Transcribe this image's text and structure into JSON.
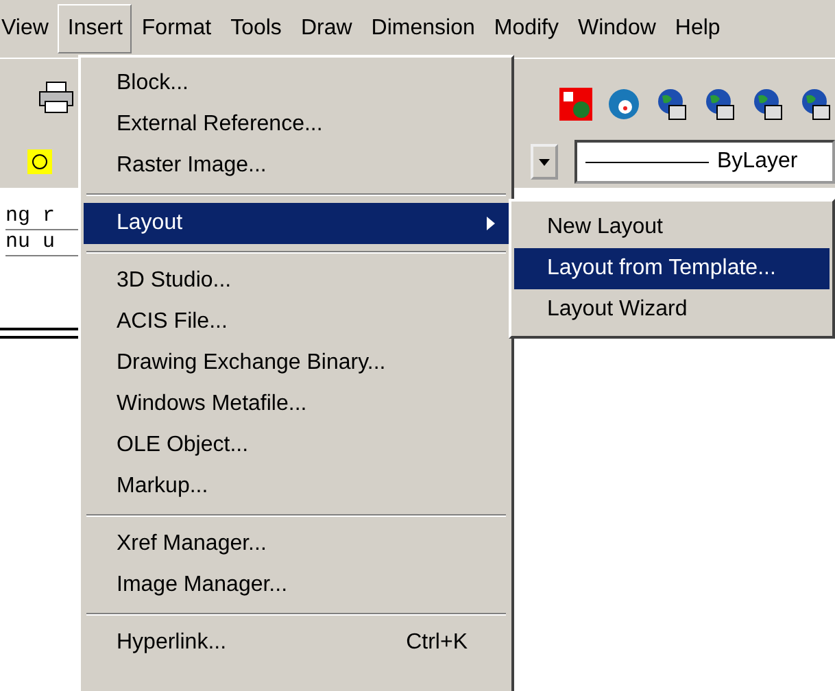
{
  "menubar": [
    {
      "label": "View",
      "selected": false
    },
    {
      "label": "Insert",
      "selected": true
    },
    {
      "label": "Format",
      "selected": false
    },
    {
      "label": "Tools",
      "selected": false
    },
    {
      "label": "Draw",
      "selected": false
    },
    {
      "label": "Dimension",
      "selected": false
    },
    {
      "label": "Modify",
      "selected": false
    },
    {
      "label": "Window",
      "selected": false
    },
    {
      "label": "Help",
      "selected": false
    }
  ],
  "linetype_field": {
    "value": "ByLayer"
  },
  "command_lines": [
    "ng r",
    "nu u"
  ],
  "insert_menu": [
    {
      "kind": "item",
      "label": "Block...",
      "selected": false
    },
    {
      "kind": "item",
      "label": "External Reference...",
      "selected": false
    },
    {
      "kind": "item",
      "label": "Raster Image...",
      "selected": false
    },
    {
      "kind": "separator"
    },
    {
      "kind": "submenu",
      "label": "Layout",
      "selected": true
    },
    {
      "kind": "separator"
    },
    {
      "kind": "item",
      "label": "3D Studio...",
      "selected": false
    },
    {
      "kind": "item",
      "label": "ACIS File...",
      "selected": false
    },
    {
      "kind": "item",
      "label": "Drawing Exchange Binary...",
      "selected": false
    },
    {
      "kind": "item",
      "label": "Windows Metafile...",
      "selected": false
    },
    {
      "kind": "item",
      "label": "OLE Object...",
      "selected": false
    },
    {
      "kind": "item",
      "label": "Markup...",
      "selected": false
    },
    {
      "kind": "separator"
    },
    {
      "kind": "item",
      "label": "Xref Manager...",
      "selected": false
    },
    {
      "kind": "item",
      "label": "Image Manager...",
      "selected": false
    },
    {
      "kind": "separator"
    },
    {
      "kind": "item",
      "label": "Hyperlink...",
      "shortcut": "Ctrl+K",
      "selected": false
    }
  ],
  "layout_submenu": [
    {
      "label": "New Layout",
      "selected": false
    },
    {
      "label": "Layout from Template...",
      "selected": true
    },
    {
      "label": "Layout Wizard",
      "selected": false
    }
  ]
}
